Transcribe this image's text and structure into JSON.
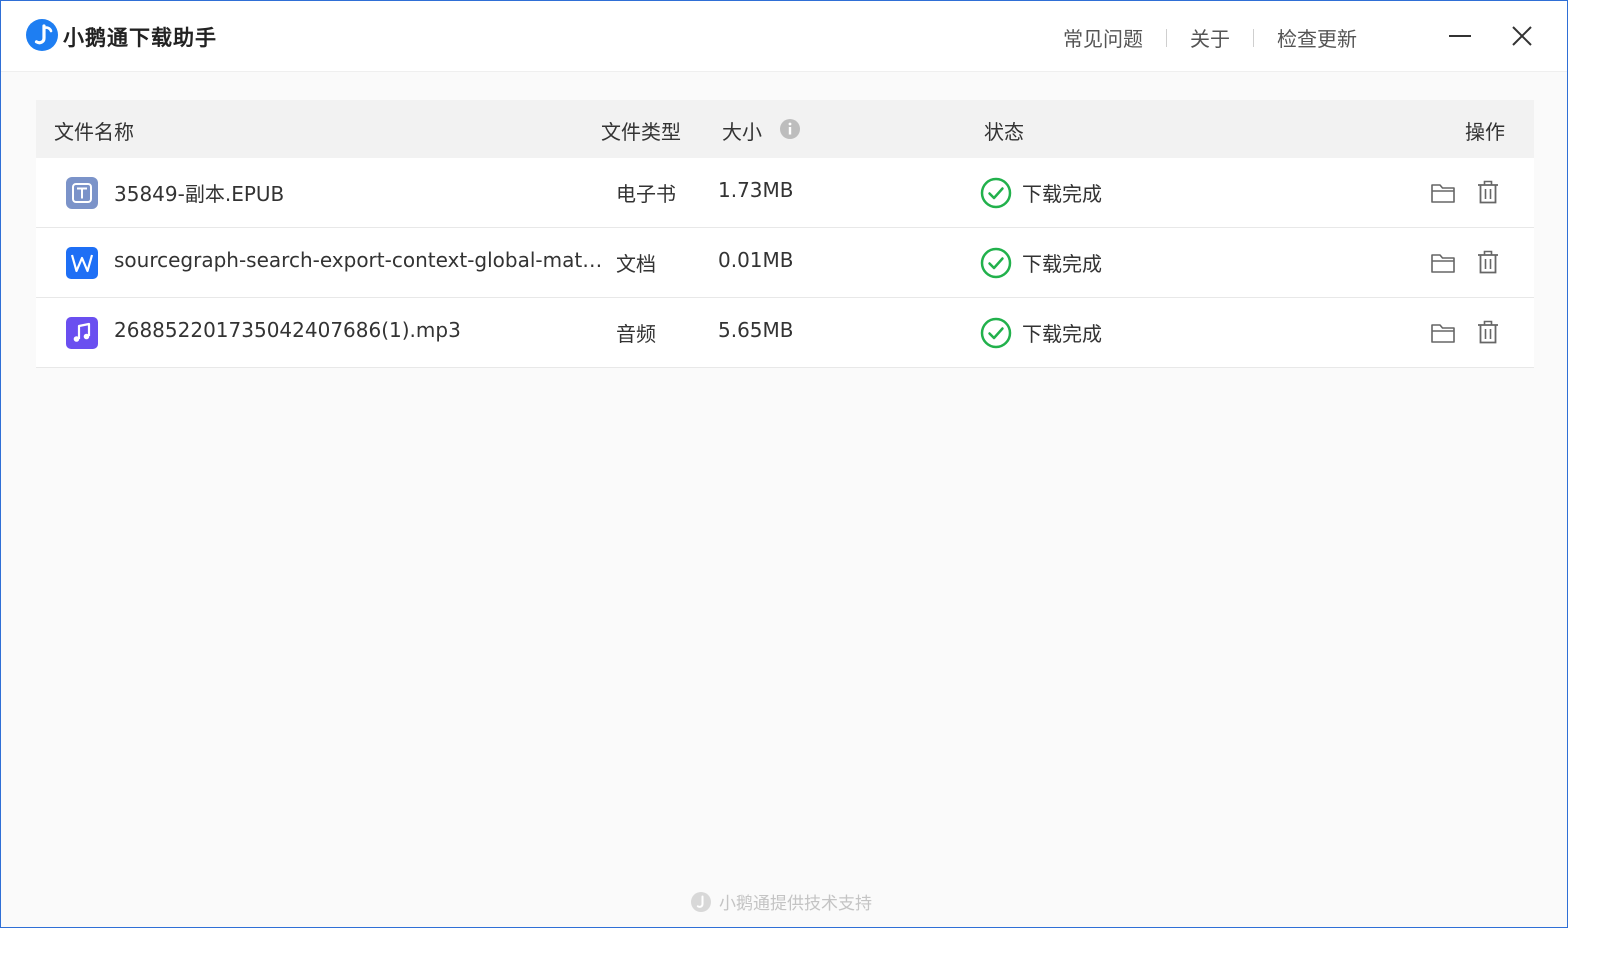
{
  "app": {
    "title": "小鹅通下载助手"
  },
  "topnav": {
    "faq": "常见问题",
    "about": "关于",
    "check_update": "检查更新"
  },
  "table": {
    "columns": {
      "name": "文件名称",
      "type": "文件类型",
      "size": "大小",
      "status": "状态",
      "actions": "操作"
    },
    "rows": [
      {
        "icon": "epub-file-icon",
        "icon_color": "#7b93c9",
        "name": "35849-副本.EPUB",
        "type": "电子书",
        "size": "1.73MB",
        "status": "下载完成"
      },
      {
        "icon": "word-file-icon",
        "icon_color": "#1e6ff5",
        "name": "sourcegraph-search-export-context-global-mate...",
        "type": "文档",
        "size": "0.01MB",
        "status": "下载完成"
      },
      {
        "icon": "audio-file-icon",
        "icon_color": "#6a4ff0",
        "name": "268852201735042407686(1).mp3",
        "type": "音频",
        "size": "5.65MB",
        "status": "下载完成"
      }
    ]
  },
  "footer": {
    "text": "小鹅通提供技术支持"
  },
  "colors": {
    "accent": "#1e7ef2",
    "success": "#22b14c",
    "window_border": "#2f6fd6"
  }
}
